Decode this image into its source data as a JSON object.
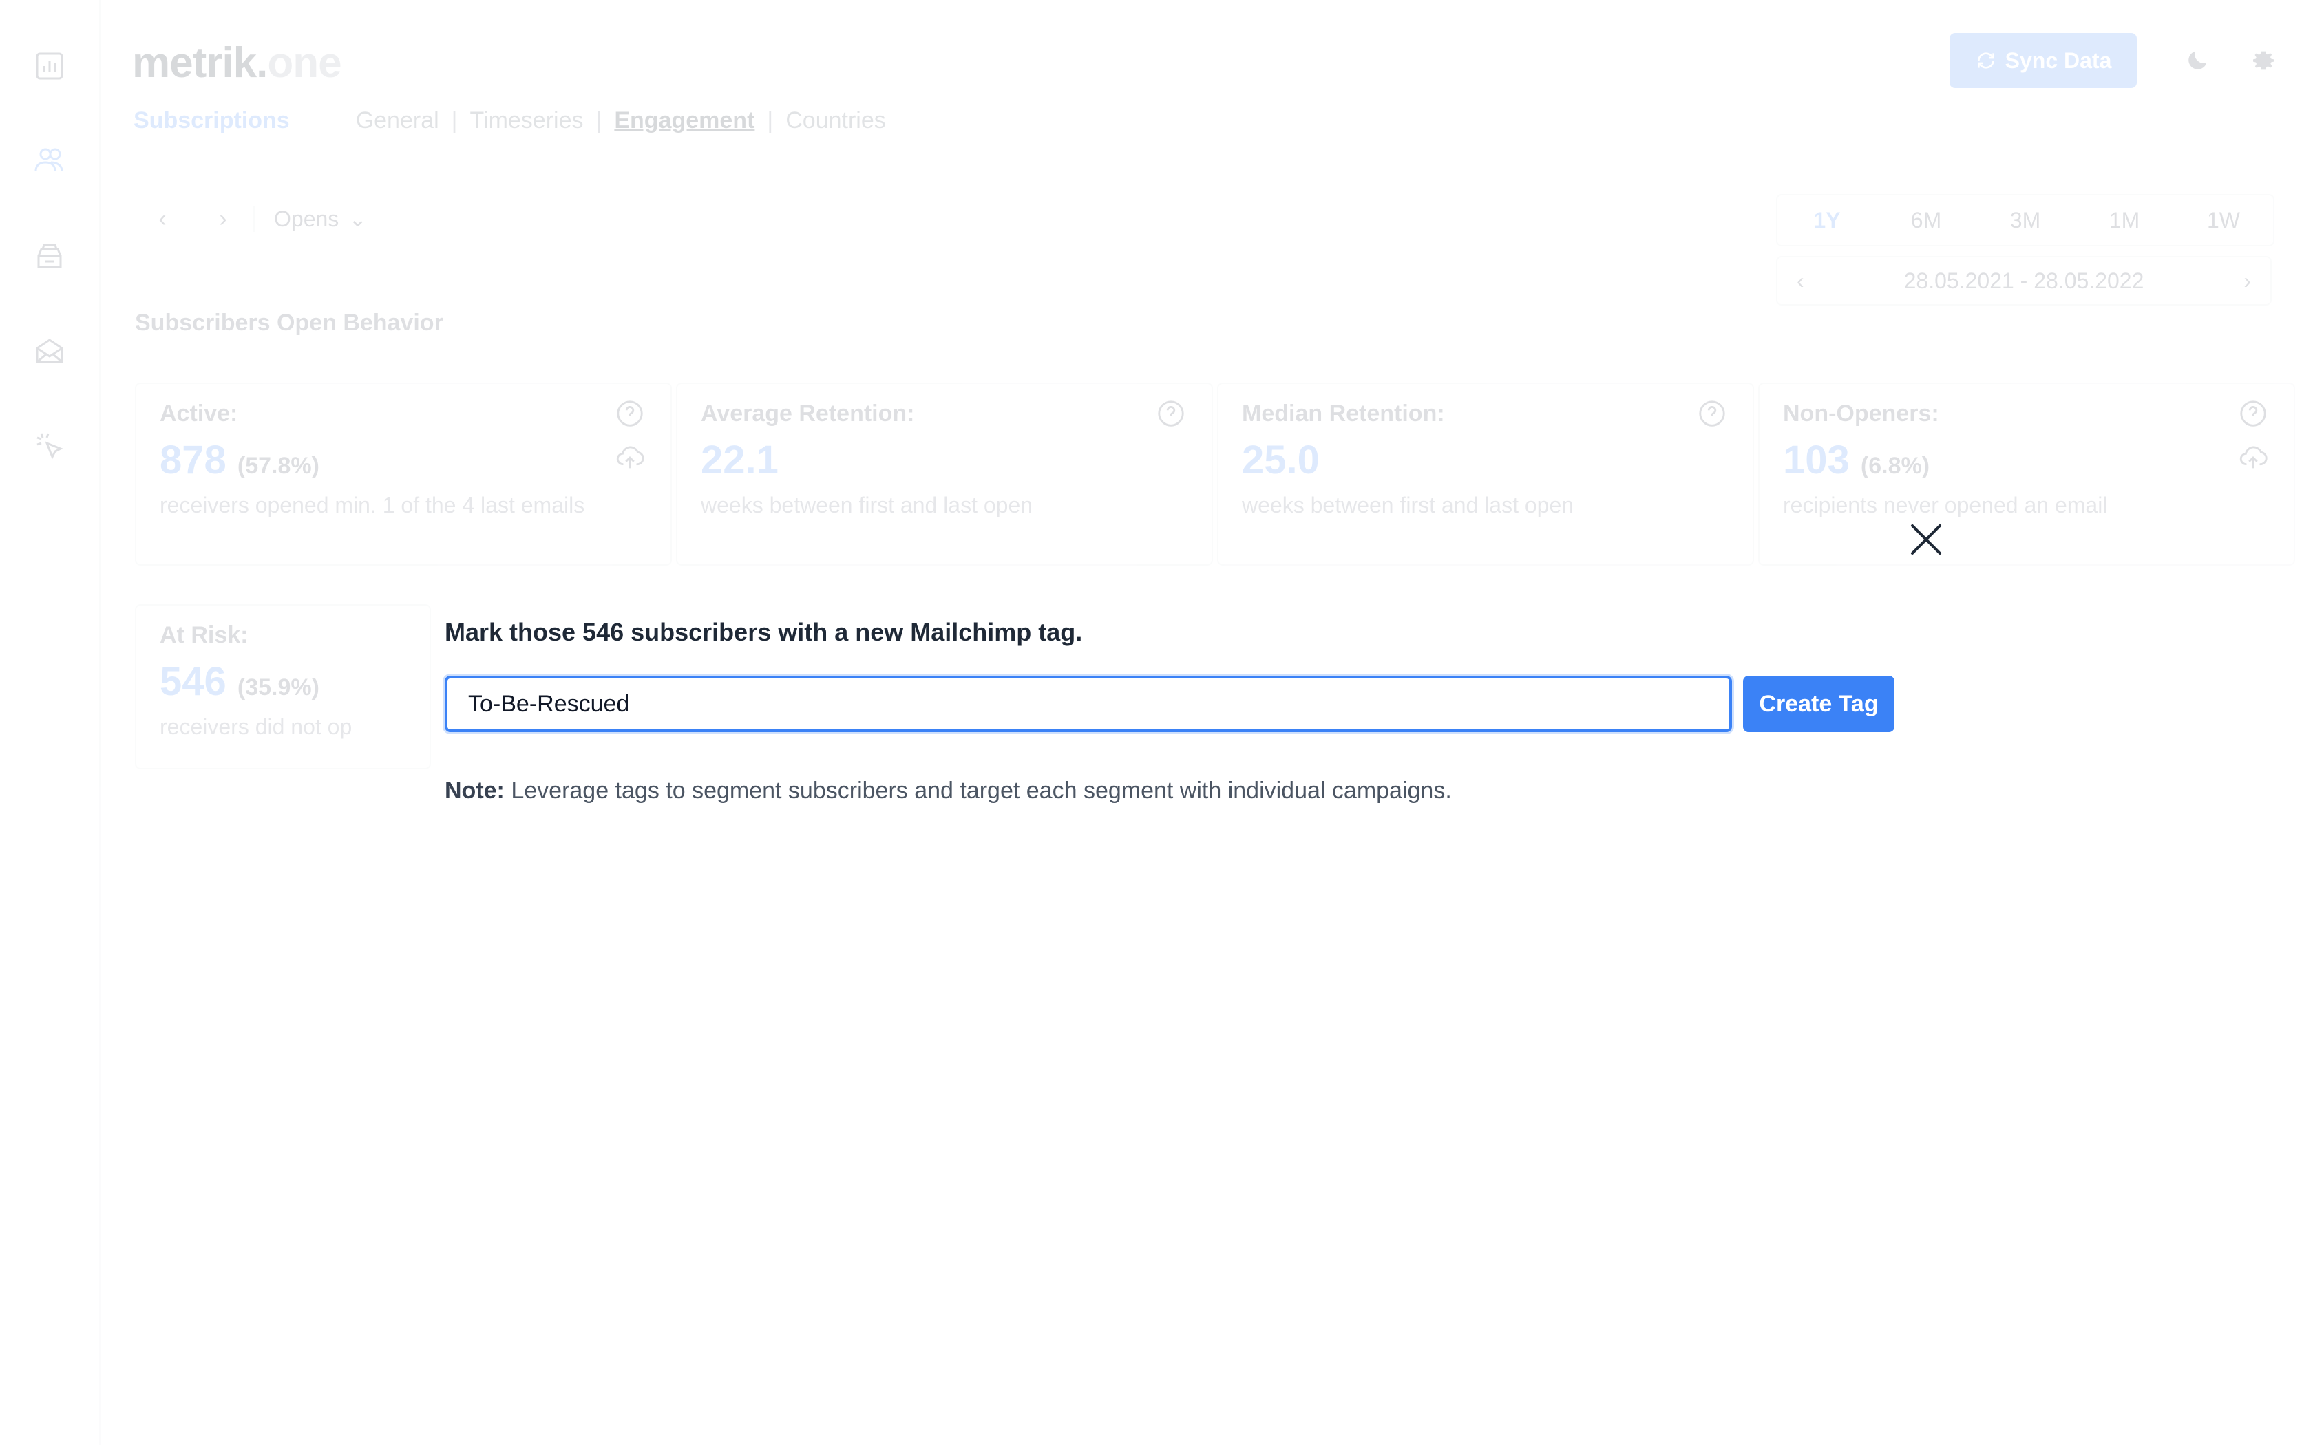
{
  "app": {
    "logo_main": "metrik.",
    "logo_accent": "one"
  },
  "sidebar": {
    "icons": [
      "bar-chart-icon",
      "users-icon",
      "inbox-stack-icon",
      "envelope-open-icon",
      "cursor-click-icon"
    ]
  },
  "header": {
    "sync_label": "Sync Data"
  },
  "tabs": {
    "section": "Subscriptions",
    "items": [
      "General",
      "Timeseries",
      "Engagement",
      "Countries"
    ],
    "active": "Engagement"
  },
  "toolbar": {
    "prev": "‹",
    "next": "›",
    "metric": "Opens"
  },
  "range": {
    "options": [
      "1Y",
      "6M",
      "3M",
      "1M",
      "1W"
    ],
    "selected": "1Y",
    "date_range": "28.05.2021 - 28.05.2022"
  },
  "section_title": "Subscribers Open Behavior",
  "cards": [
    {
      "title": "Active:",
      "value": "878",
      "pct": "(57.8%)",
      "desc": "receivers opened min. 1 of the 4 last emails"
    },
    {
      "title": "Average Retention:",
      "value": "22.1",
      "pct": "",
      "desc": "weeks between first and last open"
    },
    {
      "title": "Median Retention:",
      "value": "25.0",
      "pct": "",
      "desc": "weeks between first and last open"
    },
    {
      "title": "Non-Openers:",
      "value": "103",
      "pct": "(6.8%)",
      "desc": "recipients never opened an email"
    }
  ],
  "at_risk": {
    "title": "At Risk:",
    "value": "546",
    "pct": "(35.9%)",
    "desc": "receivers did not op"
  },
  "modal": {
    "heading": "Mark those 546 subscribers with a new Mailchimp tag.",
    "input_value": "To-Be-Rescued",
    "button_label": "Create Tag",
    "note_label": "Note:",
    "note_text": " Leverage tags to segment subscribers and target each segment with individual campaigns."
  },
  "colors": {
    "accent": "#3b82f6",
    "text": "#1f2937",
    "muted": "#6b7280"
  }
}
